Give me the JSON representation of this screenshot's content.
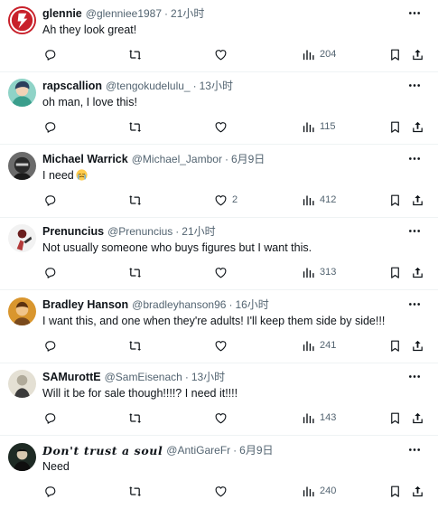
{
  "replies": [
    {
      "name": "glennie",
      "handle": "@glenniee1987",
      "time": "21小时",
      "text": "Ah they look great!",
      "likes": "",
      "views": "204",
      "avatar_color": "#c8202a"
    },
    {
      "name": "rapscallion",
      "handle": "@tengokudelulu_",
      "time": "13小时",
      "text": "oh man, I love this!",
      "likes": "",
      "views": "115",
      "avatar_color": "#3a9e8c"
    },
    {
      "name": "Michael Warrick",
      "handle": "@Michael_Jambor",
      "time": "6月9日",
      "text": "I need",
      "likes": "2",
      "views": "412",
      "avatar_color": "#2a2a2a"
    },
    {
      "name": "Prenuncius",
      "handle": "@Prenuncius",
      "time": "21小时",
      "text": "Not usually someone who buys figures but I want this.",
      "likes": "",
      "views": "313",
      "avatar_color": "#b33a3a"
    },
    {
      "name": "Bradley Hanson",
      "handle": "@bradleyhanson96",
      "time": "16小时",
      "text": "I want this, and one when they're adults! I'll keep them side by side!!!",
      "likes": "",
      "views": "241",
      "avatar_color": "#d9962e"
    },
    {
      "name": "SAMurottE",
      "handle": "@SamEisenach",
      "time": "13小时",
      "text": "Will it be for sale though!!!!? I need it!!!!",
      "likes": "",
      "views": "143",
      "avatar_color": "#b0aa9a"
    },
    {
      "name": "Don't trust a soul",
      "handle": "@AntiGareFr",
      "time": "6月9日",
      "text": "Need",
      "likes": "",
      "views": "240",
      "avatar_color": "#1e2a24"
    }
  ]
}
